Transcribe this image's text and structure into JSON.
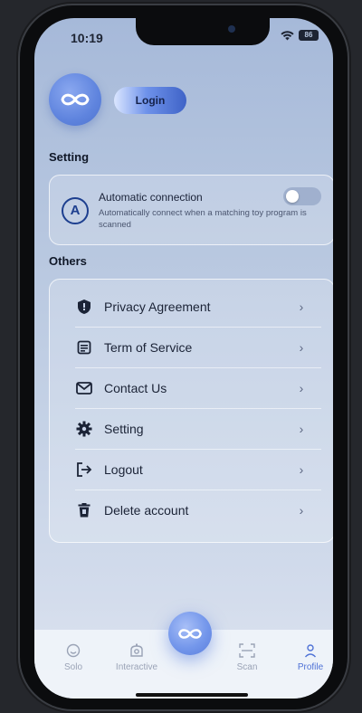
{
  "status_bar": {
    "time": "10:19",
    "battery": "86"
  },
  "header": {
    "login_label": "Login"
  },
  "setting_section": {
    "title": "Setting",
    "auto_connection": {
      "icon_letter": "A",
      "title": "Automatic connection",
      "description": "Automatically connect when a matching toy program is scanned",
      "enabled": false
    }
  },
  "others_section": {
    "title": "Others",
    "items": [
      {
        "label": "Privacy Agreement",
        "icon": "shield-icon"
      },
      {
        "label": "Term of Service",
        "icon": "document-icon"
      },
      {
        "label": "Contact Us",
        "icon": "mail-icon"
      },
      {
        "label": "Setting",
        "icon": "gear-icon"
      },
      {
        "label": "Logout",
        "icon": "logout-icon"
      },
      {
        "label": "Delete account",
        "icon": "trash-icon"
      }
    ]
  },
  "tabbar": {
    "tabs": [
      {
        "label": "Solo",
        "active": false
      },
      {
        "label": "Interactive",
        "active": false
      },
      {
        "label": "Scan",
        "active": false
      },
      {
        "label": "Profile",
        "active": true
      }
    ]
  },
  "colors": {
    "accent": "#4f72d6",
    "brand": "#5f84de",
    "text": "#1b2336"
  }
}
